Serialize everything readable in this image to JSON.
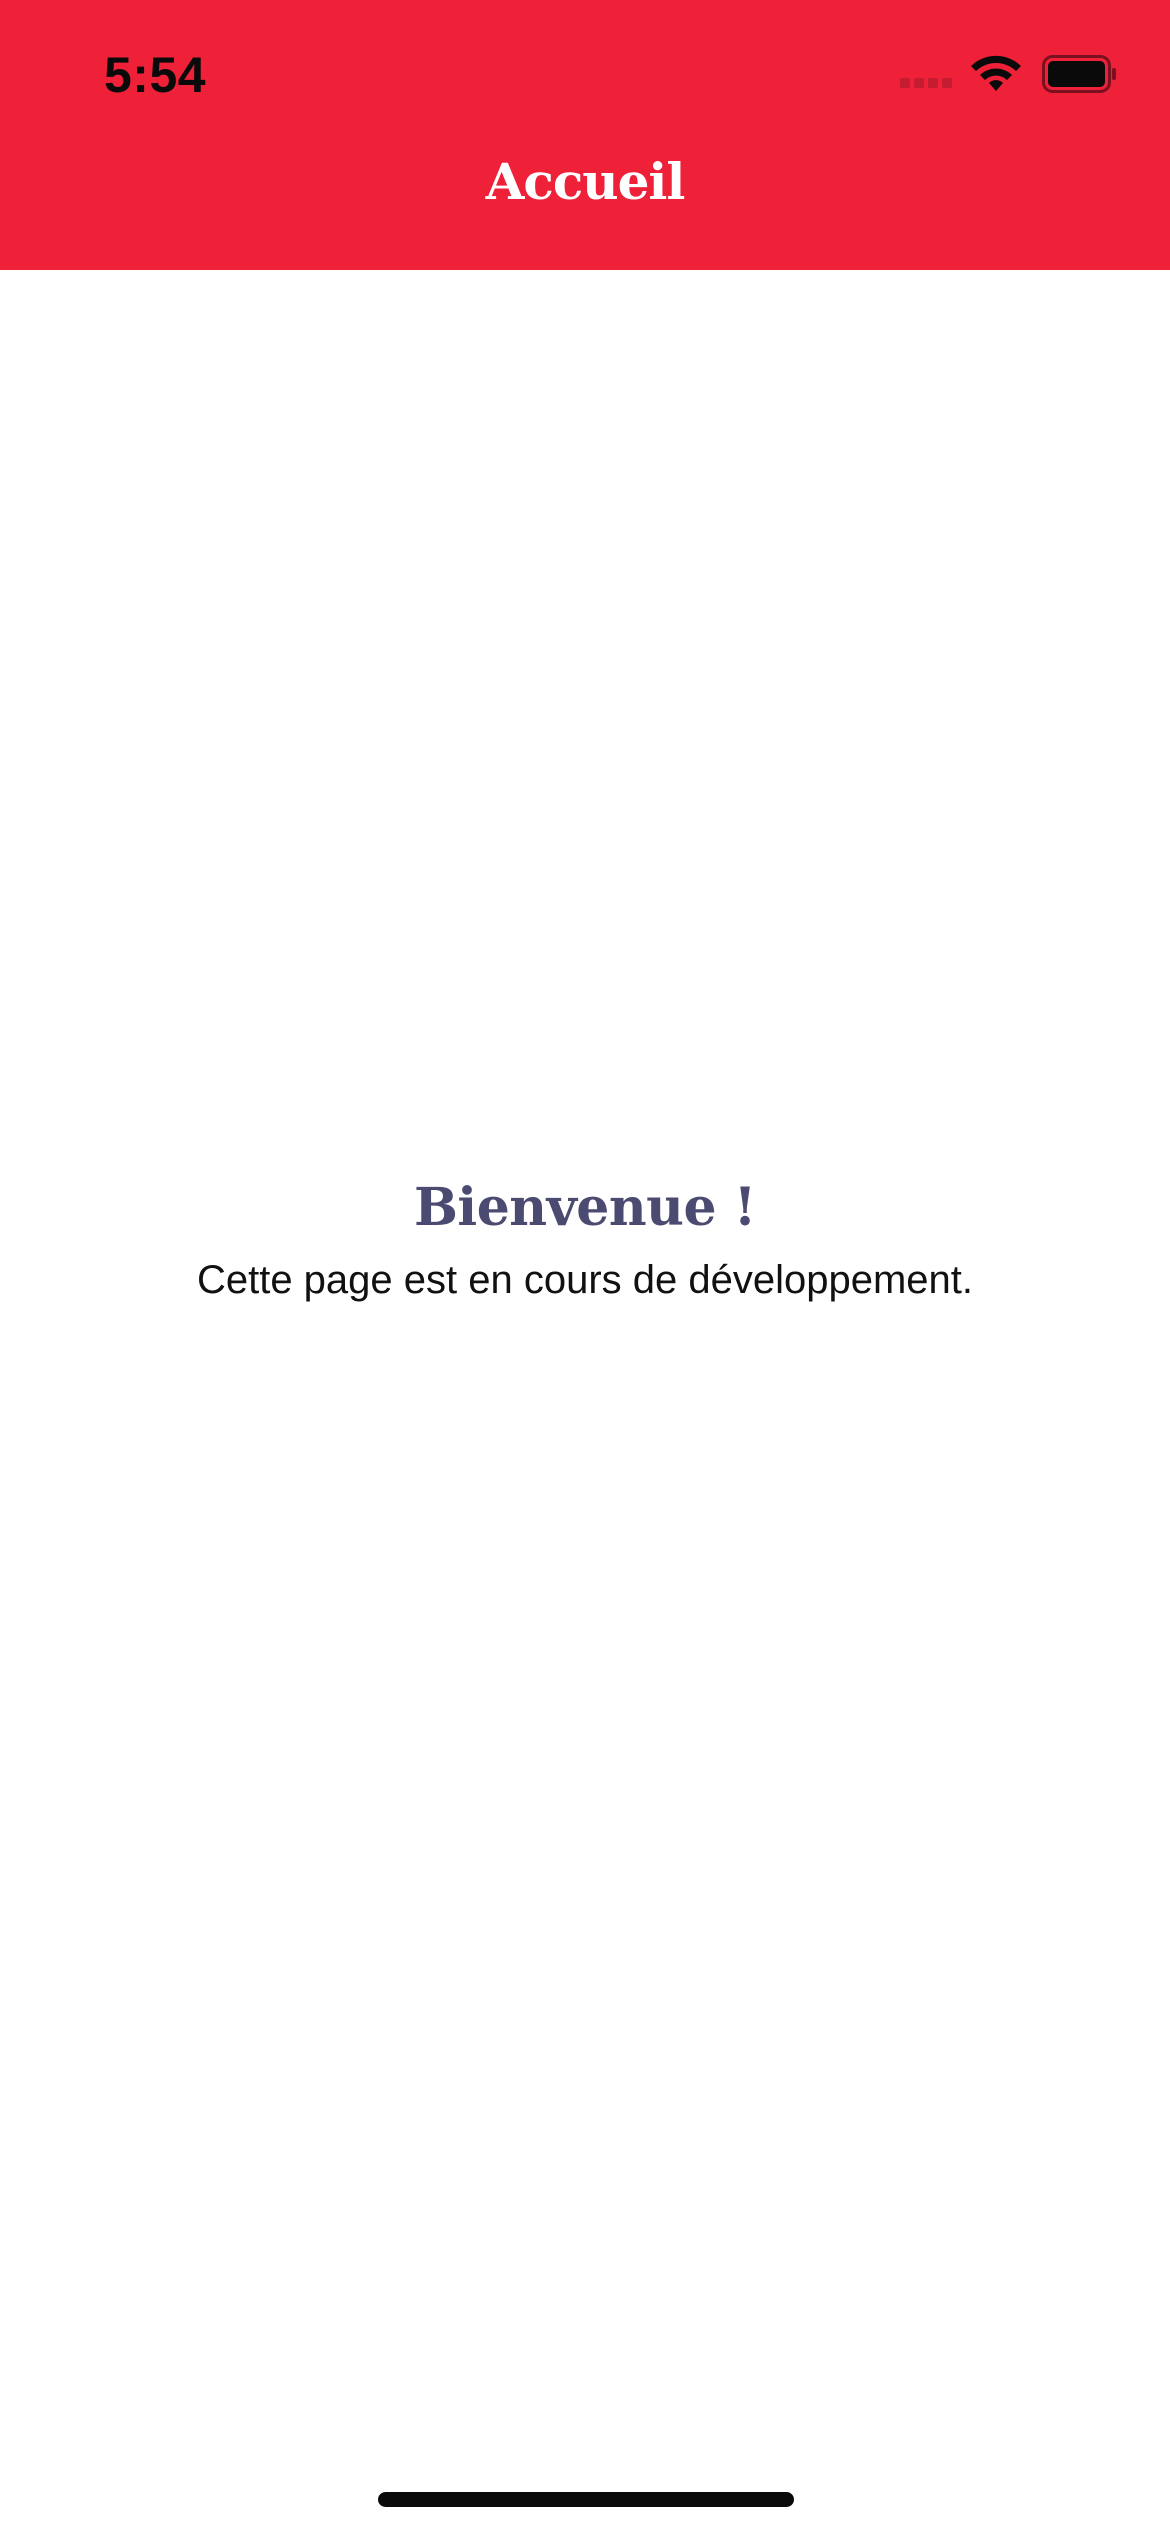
{
  "status_bar": {
    "time": "5:54",
    "signal_icon": "cellular-signal-icon",
    "wifi_icon": "wifi-icon",
    "battery_icon": "battery-icon"
  },
  "nav_bar": {
    "title": "Accueil"
  },
  "main": {
    "welcome_title": "Bienvenue !",
    "welcome_subtitle": "Cette page est en cours de développement."
  },
  "colors": {
    "header_background": "#ee2139",
    "title_color": "#4b4a70",
    "page_background": "#ffffff"
  }
}
